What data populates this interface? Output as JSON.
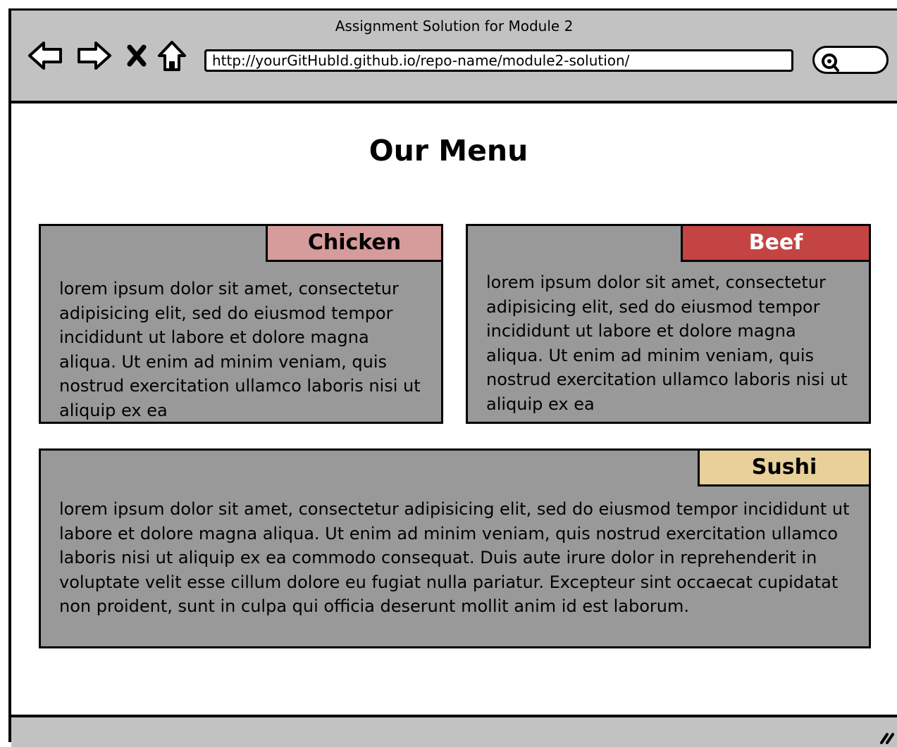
{
  "window": {
    "title": "Assignment Solution for Module 2",
    "url": "http://yourGitHubId.github.io/repo-name/module2-solution/"
  },
  "icons": [
    "back-arrow-icon",
    "forward-arrow-icon",
    "close-x-icon",
    "home-icon",
    "search-icon",
    "resize-grip-icon"
  ],
  "page": {
    "title": "Our Menu"
  },
  "cards": [
    {
      "label": "Chicken",
      "label_color": "#d69b9b",
      "label_text_color": "#000000",
      "text": "lorem ipsum dolor sit amet, consectetur adipisicing elit, sed do eiusmod tempor incididunt ut labore et dolore magna aliqua. Ut enim ad minim veniam, quis nostrud exercitation ullamco laboris nisi ut aliquip ex ea"
    },
    {
      "label": "Beef",
      "label_color": "#c44444",
      "label_text_color": "#ffffff",
      "text": "lorem ipsum dolor sit amet, consectetur adipisicing elit, sed do eiusmod tempor incididunt ut labore et dolore magna aliqua. Ut enim ad minim veniam, quis nostrud exercitation ullamco laboris nisi ut aliquip ex ea"
    },
    {
      "label": "Sushi",
      "label_color": "#e8d09a",
      "label_text_color": "#000000",
      "text": "lorem ipsum dolor sit amet, consectetur adipisicing elit, sed do eiusmod tempor incididunt ut labore et dolore magna aliqua. Ut enim ad minim veniam, quis nostrud exercitation ullamco laboris nisi ut aliquip ex ea commodo consequat. Duis aute irure dolor in reprehenderit in voluptate velit esse cillum dolore eu fugiat nulla pariatur. Excepteur sint occaecat cupidatat non proident, sunt in culpa qui officia deserunt mollit anim id est laborum."
    }
  ],
  "colors": {
    "chrome": "#c2c2c2",
    "card_body": "#999999"
  }
}
